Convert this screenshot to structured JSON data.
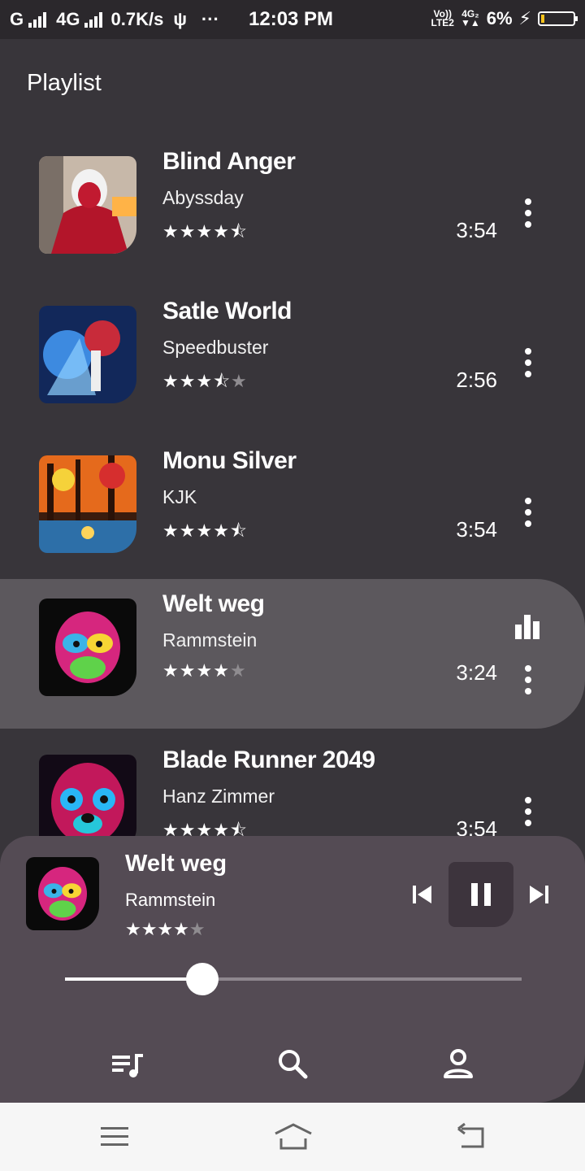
{
  "status": {
    "carrier1": "G",
    "carrier2": "4G",
    "speed": "0.7K/s",
    "usb": "ψ",
    "more": "···",
    "time": "12:03 PM",
    "volte_top": "Vo))",
    "volte_bottom": "LTE2",
    "net_top": "4G₂",
    "net_bottom": "▼▲",
    "battery_percent": "6%",
    "battery_level": 0.06
  },
  "page_title": "Playlist",
  "songs": [
    {
      "title": "Blind Anger",
      "artist": "Abyssday",
      "duration": "3:54",
      "rating": 4.5,
      "rating_stars": "★★★★⯪",
      "playing": false
    },
    {
      "title": "Satle World",
      "artist": "Speedbuster",
      "duration": "2:56",
      "rating": 3.5,
      "rating_stars": "★★★⯪★",
      "playing": false
    },
    {
      "title": "Monu Silver",
      "artist": "KJK",
      "duration": "3:54",
      "rating": 4.5,
      "rating_stars": "★★★★⯪",
      "playing": false
    },
    {
      "title": "Welt weg",
      "artist": "Rammstein",
      "duration": "3:24",
      "rating": 4,
      "rating_stars": "★★★★★",
      "playing": true
    },
    {
      "title": "Blade Runner 2049",
      "artist": "Hanz Zimmer",
      "duration": "3:54",
      "rating": 4.5,
      "rating_stars": "★★★★★",
      "playing": false
    }
  ],
  "now_playing": {
    "title": "Welt weg",
    "artist": "Rammstein",
    "rating": 4,
    "progress": 0.3
  },
  "bottom_nav": [
    "playlist-icon",
    "search-icon",
    "account-icon"
  ],
  "colors": {
    "background": "#38353a",
    "active_row": "#5c585d",
    "player": "#544b54",
    "pause_box": "#3d343d"
  }
}
